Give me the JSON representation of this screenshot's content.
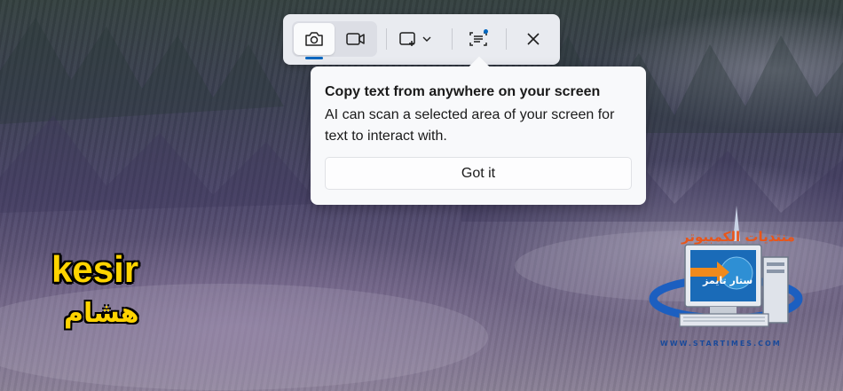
{
  "snipping_toolbar": {
    "modes": [
      {
        "name": "camera-icon",
        "active": true
      },
      {
        "name": "video-camera-icon",
        "active": false
      }
    ],
    "shape_icon": "rectangle-snip-icon",
    "text_action_icon": "text-actions-icon",
    "close_icon": "close-icon"
  },
  "popup": {
    "title": "Copy text from anywhere on your screen",
    "body": "AI can scan a selected area of your screen for text to interact with.",
    "button_label": "Got it"
  },
  "overlay": {
    "english_name": "kesir",
    "arabic_name": "هشام"
  },
  "logo": {
    "top_text": "منتديات الكمبيوتر",
    "middle_text": "ستار تايمز",
    "url": "WWW.STARTIMES.COM"
  },
  "colors": {
    "accent": "#0067c0",
    "overlay_text": "#ffd400",
    "logo_orange": "#e8561b",
    "logo_blue": "#1a4a9a"
  }
}
